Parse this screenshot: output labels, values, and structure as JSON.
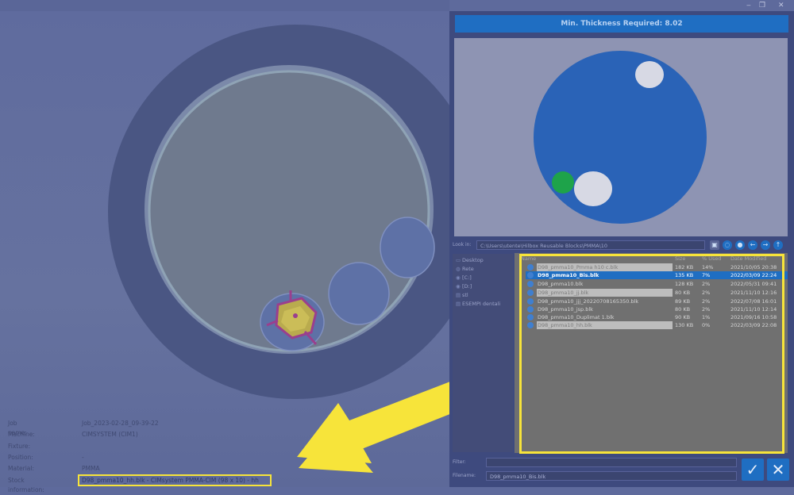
{
  "window": {
    "restore": "❐",
    "close": "✕",
    "minimize": "‒"
  },
  "banner": "Min. Thickness Required: 8.02",
  "look_in": {
    "label": "Look in:",
    "path": "C:\\Users\\utente\\Hilbox Reusable Blocks\\PMMA\\10"
  },
  "nav_icons": [
    "folder-new-icon",
    "arrow-left-icon",
    "arrow-right-icon",
    "arrow-up-icon"
  ],
  "places": [
    {
      "label": "Desktop",
      "icon": "desktop-icon"
    },
    {
      "label": "Rete",
      "icon": "network-icon"
    },
    {
      "label": "[C:]",
      "icon": "drive-icon"
    },
    {
      "label": "[D:]",
      "icon": "drive-icon"
    },
    {
      "label": "stl",
      "icon": "folder-icon"
    },
    {
      "label": "ESEMPI dentali",
      "icon": "folder-icon"
    }
  ],
  "columns": {
    "name": "Name",
    "size": "Size",
    "used": "% Used",
    "modified": "Date Modified"
  },
  "files": [
    {
      "name": "D98_pmma10_Pmma h10 c.blk",
      "size": "182 KB",
      "used": "14%",
      "date": "2021/10/05 20:38"
    },
    {
      "name": "D98_pmma10_Bis.blk",
      "size": "135 KB",
      "used": "7%",
      "date": "2022/03/09 22:24"
    },
    {
      "name": "D98_pmma10.blk",
      "size": "128 KB",
      "used": "2%",
      "date": "2022/05/31 09:41"
    },
    {
      "name": "D98_pmma10_jj.blk",
      "size": "80 KB",
      "used": "2%",
      "date": "2021/11/10 12:16"
    },
    {
      "name": "D98_pmma10_jjj_20220708165350.blk",
      "size": "89 KB",
      "used": "2%",
      "date": "2022/07/08 16:01"
    },
    {
      "name": "D98_pmma10_jsp.blk",
      "size": "80 KB",
      "used": "2%",
      "date": "2021/11/10 12:14"
    },
    {
      "name": "D98_pmma10_Duplimat 1.blk",
      "size": "90 KB",
      "used": "1%",
      "date": "2021/09/16 10:58"
    },
    {
      "name": "D98_pmma10_hh.blk",
      "size": "130 KB",
      "used": "0%",
      "date": "2022/03/09 22:08"
    }
  ],
  "filter": {
    "label": "Filter:",
    "value": ""
  },
  "filename": {
    "label": "Filename:",
    "value": "D98_pmma10_Bis.blk"
  },
  "buttons": {
    "ok": "✓",
    "cancel": "✕"
  },
  "job": {
    "name_label": "Job name:",
    "name": "Job_2023-02-28_09-39-22",
    "machine_label": "Machine:",
    "machine": "CIMSYSTEM (CIM1)",
    "fixture_label": "Fixture:",
    "fixture": "",
    "position_label": "Position:",
    "position": "-",
    "material_label": "Material:",
    "material": "PMMA",
    "stock_label": "Stock information:",
    "stock": "D98_pmma10_hh.blk - CIMsystem PMMA-CIM (98 x 10) - hh"
  },
  "colors": {
    "accent": "#1f6ec2",
    "highlight": "#f7e43a",
    "preview_disc": "#2a63b7",
    "pocket": "#1ea34a"
  }
}
